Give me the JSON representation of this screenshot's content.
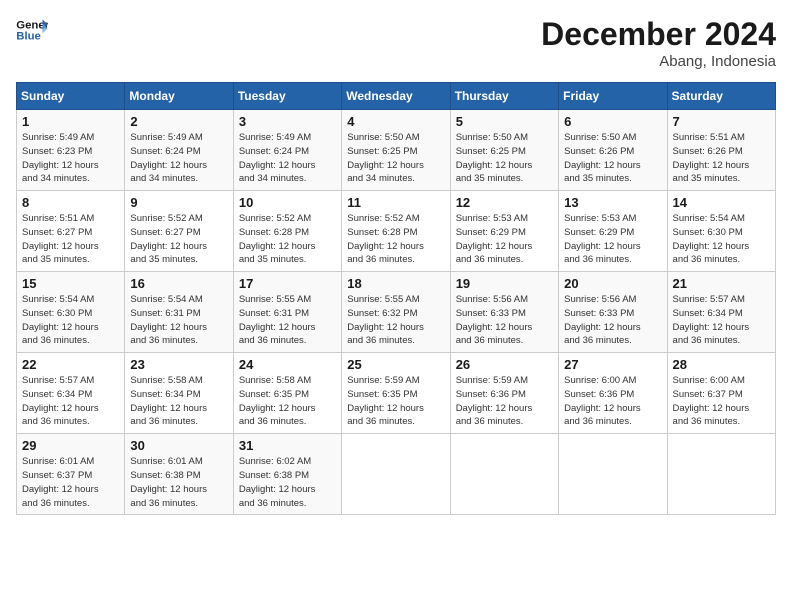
{
  "logo": {
    "line1": "General",
    "line2": "Blue"
  },
  "title": "December 2024",
  "subtitle": "Abang, Indonesia",
  "days_of_week": [
    "Sunday",
    "Monday",
    "Tuesday",
    "Wednesday",
    "Thursday",
    "Friday",
    "Saturday"
  ],
  "weeks": [
    [
      {
        "day": "1",
        "info": "Sunrise: 5:49 AM\nSunset: 6:23 PM\nDaylight: 12 hours\nand 34 minutes."
      },
      {
        "day": "2",
        "info": "Sunrise: 5:49 AM\nSunset: 6:24 PM\nDaylight: 12 hours\nand 34 minutes."
      },
      {
        "day": "3",
        "info": "Sunrise: 5:49 AM\nSunset: 6:24 PM\nDaylight: 12 hours\nand 34 minutes."
      },
      {
        "day": "4",
        "info": "Sunrise: 5:50 AM\nSunset: 6:25 PM\nDaylight: 12 hours\nand 34 minutes."
      },
      {
        "day": "5",
        "info": "Sunrise: 5:50 AM\nSunset: 6:25 PM\nDaylight: 12 hours\nand 35 minutes."
      },
      {
        "day": "6",
        "info": "Sunrise: 5:50 AM\nSunset: 6:26 PM\nDaylight: 12 hours\nand 35 minutes."
      },
      {
        "day": "7",
        "info": "Sunrise: 5:51 AM\nSunset: 6:26 PM\nDaylight: 12 hours\nand 35 minutes."
      }
    ],
    [
      {
        "day": "8",
        "info": "Sunrise: 5:51 AM\nSunset: 6:27 PM\nDaylight: 12 hours\nand 35 minutes."
      },
      {
        "day": "9",
        "info": "Sunrise: 5:52 AM\nSunset: 6:27 PM\nDaylight: 12 hours\nand 35 minutes."
      },
      {
        "day": "10",
        "info": "Sunrise: 5:52 AM\nSunset: 6:28 PM\nDaylight: 12 hours\nand 35 minutes."
      },
      {
        "day": "11",
        "info": "Sunrise: 5:52 AM\nSunset: 6:28 PM\nDaylight: 12 hours\nand 36 minutes."
      },
      {
        "day": "12",
        "info": "Sunrise: 5:53 AM\nSunset: 6:29 PM\nDaylight: 12 hours\nand 36 minutes."
      },
      {
        "day": "13",
        "info": "Sunrise: 5:53 AM\nSunset: 6:29 PM\nDaylight: 12 hours\nand 36 minutes."
      },
      {
        "day": "14",
        "info": "Sunrise: 5:54 AM\nSunset: 6:30 PM\nDaylight: 12 hours\nand 36 minutes."
      }
    ],
    [
      {
        "day": "15",
        "info": "Sunrise: 5:54 AM\nSunset: 6:30 PM\nDaylight: 12 hours\nand 36 minutes."
      },
      {
        "day": "16",
        "info": "Sunrise: 5:54 AM\nSunset: 6:31 PM\nDaylight: 12 hours\nand 36 minutes."
      },
      {
        "day": "17",
        "info": "Sunrise: 5:55 AM\nSunset: 6:31 PM\nDaylight: 12 hours\nand 36 minutes."
      },
      {
        "day": "18",
        "info": "Sunrise: 5:55 AM\nSunset: 6:32 PM\nDaylight: 12 hours\nand 36 minutes."
      },
      {
        "day": "19",
        "info": "Sunrise: 5:56 AM\nSunset: 6:33 PM\nDaylight: 12 hours\nand 36 minutes."
      },
      {
        "day": "20",
        "info": "Sunrise: 5:56 AM\nSunset: 6:33 PM\nDaylight: 12 hours\nand 36 minutes."
      },
      {
        "day": "21",
        "info": "Sunrise: 5:57 AM\nSunset: 6:34 PM\nDaylight: 12 hours\nand 36 minutes."
      }
    ],
    [
      {
        "day": "22",
        "info": "Sunrise: 5:57 AM\nSunset: 6:34 PM\nDaylight: 12 hours\nand 36 minutes."
      },
      {
        "day": "23",
        "info": "Sunrise: 5:58 AM\nSunset: 6:34 PM\nDaylight: 12 hours\nand 36 minutes."
      },
      {
        "day": "24",
        "info": "Sunrise: 5:58 AM\nSunset: 6:35 PM\nDaylight: 12 hours\nand 36 minutes."
      },
      {
        "day": "25",
        "info": "Sunrise: 5:59 AM\nSunset: 6:35 PM\nDaylight: 12 hours\nand 36 minutes."
      },
      {
        "day": "26",
        "info": "Sunrise: 5:59 AM\nSunset: 6:36 PM\nDaylight: 12 hours\nand 36 minutes."
      },
      {
        "day": "27",
        "info": "Sunrise: 6:00 AM\nSunset: 6:36 PM\nDaylight: 12 hours\nand 36 minutes."
      },
      {
        "day": "28",
        "info": "Sunrise: 6:00 AM\nSunset: 6:37 PM\nDaylight: 12 hours\nand 36 minutes."
      }
    ],
    [
      {
        "day": "29",
        "info": "Sunrise: 6:01 AM\nSunset: 6:37 PM\nDaylight: 12 hours\nand 36 minutes."
      },
      {
        "day": "30",
        "info": "Sunrise: 6:01 AM\nSunset: 6:38 PM\nDaylight: 12 hours\nand 36 minutes."
      },
      {
        "day": "31",
        "info": "Sunrise: 6:02 AM\nSunset: 6:38 PM\nDaylight: 12 hours\nand 36 minutes."
      },
      {
        "day": "",
        "info": ""
      },
      {
        "day": "",
        "info": ""
      },
      {
        "day": "",
        "info": ""
      },
      {
        "day": "",
        "info": ""
      }
    ]
  ]
}
